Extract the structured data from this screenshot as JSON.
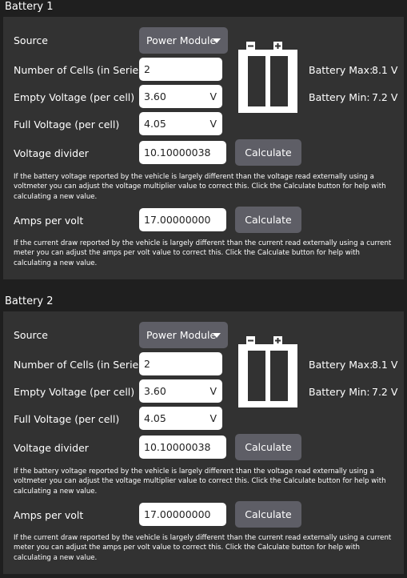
{
  "batteries": [
    {
      "title": "Battery 1",
      "source_label": "Source",
      "source_value": "Power Module",
      "cells_label": "Number of Cells (in Series)",
      "cells_value": "2",
      "empty_label": "Empty Voltage (per cell)",
      "empty_value": "3.60",
      "empty_unit": "V",
      "full_label": "Full Voltage (per cell)",
      "full_value": "4.05",
      "full_unit": "V",
      "divider_label": "Voltage divider",
      "divider_value": "10.10000038",
      "divider_button": "Calculate",
      "divider_help": "If the battery voltage reported by the vehicle is largely different than the voltage read externally using a voltmeter you can adjust the voltage multiplier value to correct this. Click the Calculate button for help with calculating a new value.",
      "amps_label": "Amps per volt",
      "amps_value": "17.00000000",
      "amps_button": "Calculate",
      "amps_help": "If the current draw reported by the vehicle is largely different than the current read externally using a current meter you can adjust the amps per volt value to correct this. Click the Calculate button for help with calculating a new value.",
      "max_label": "Battery Max:",
      "max_value": "8.1 V",
      "min_label": "Battery Min:",
      "min_value": "7.2 V"
    },
    {
      "title": "Battery 2",
      "source_label": "Source",
      "source_value": "Power Module",
      "cells_label": "Number of Cells (in Series)",
      "cells_value": "2",
      "empty_label": "Empty Voltage (per cell)",
      "empty_value": "3.60",
      "empty_unit": "V",
      "full_label": "Full Voltage (per cell)",
      "full_value": "4.05",
      "full_unit": "V",
      "divider_label": "Voltage divider",
      "divider_value": "10.10000038",
      "divider_button": "Calculate",
      "divider_help": "If the battery voltage reported by the vehicle is largely different than the voltage read externally using a voltmeter you can adjust the voltage multiplier value to correct this. Click the Calculate button for help with calculating a new value.",
      "amps_label": "Amps per volt",
      "amps_value": "17.00000000",
      "amps_button": "Calculate",
      "amps_help": "If the current draw reported by the vehicle is largely different than the current read externally using a current meter you can adjust the amps per volt value to correct this. Click the Calculate button for help with calculating a new value.",
      "max_label": "Battery Max:",
      "max_value": "8.1 V",
      "min_label": "Battery Min:",
      "min_value": "7.2 V"
    }
  ],
  "icons": {
    "battery": "battery-icon",
    "minus": "minus-terminal-icon",
    "plus": "plus-terminal-icon",
    "dropdown": "chevron-down-icon"
  },
  "colors": {
    "background": "#1f1f1f",
    "panel": "#323232",
    "button": "#5e5e66",
    "field": "#ffffff"
  }
}
